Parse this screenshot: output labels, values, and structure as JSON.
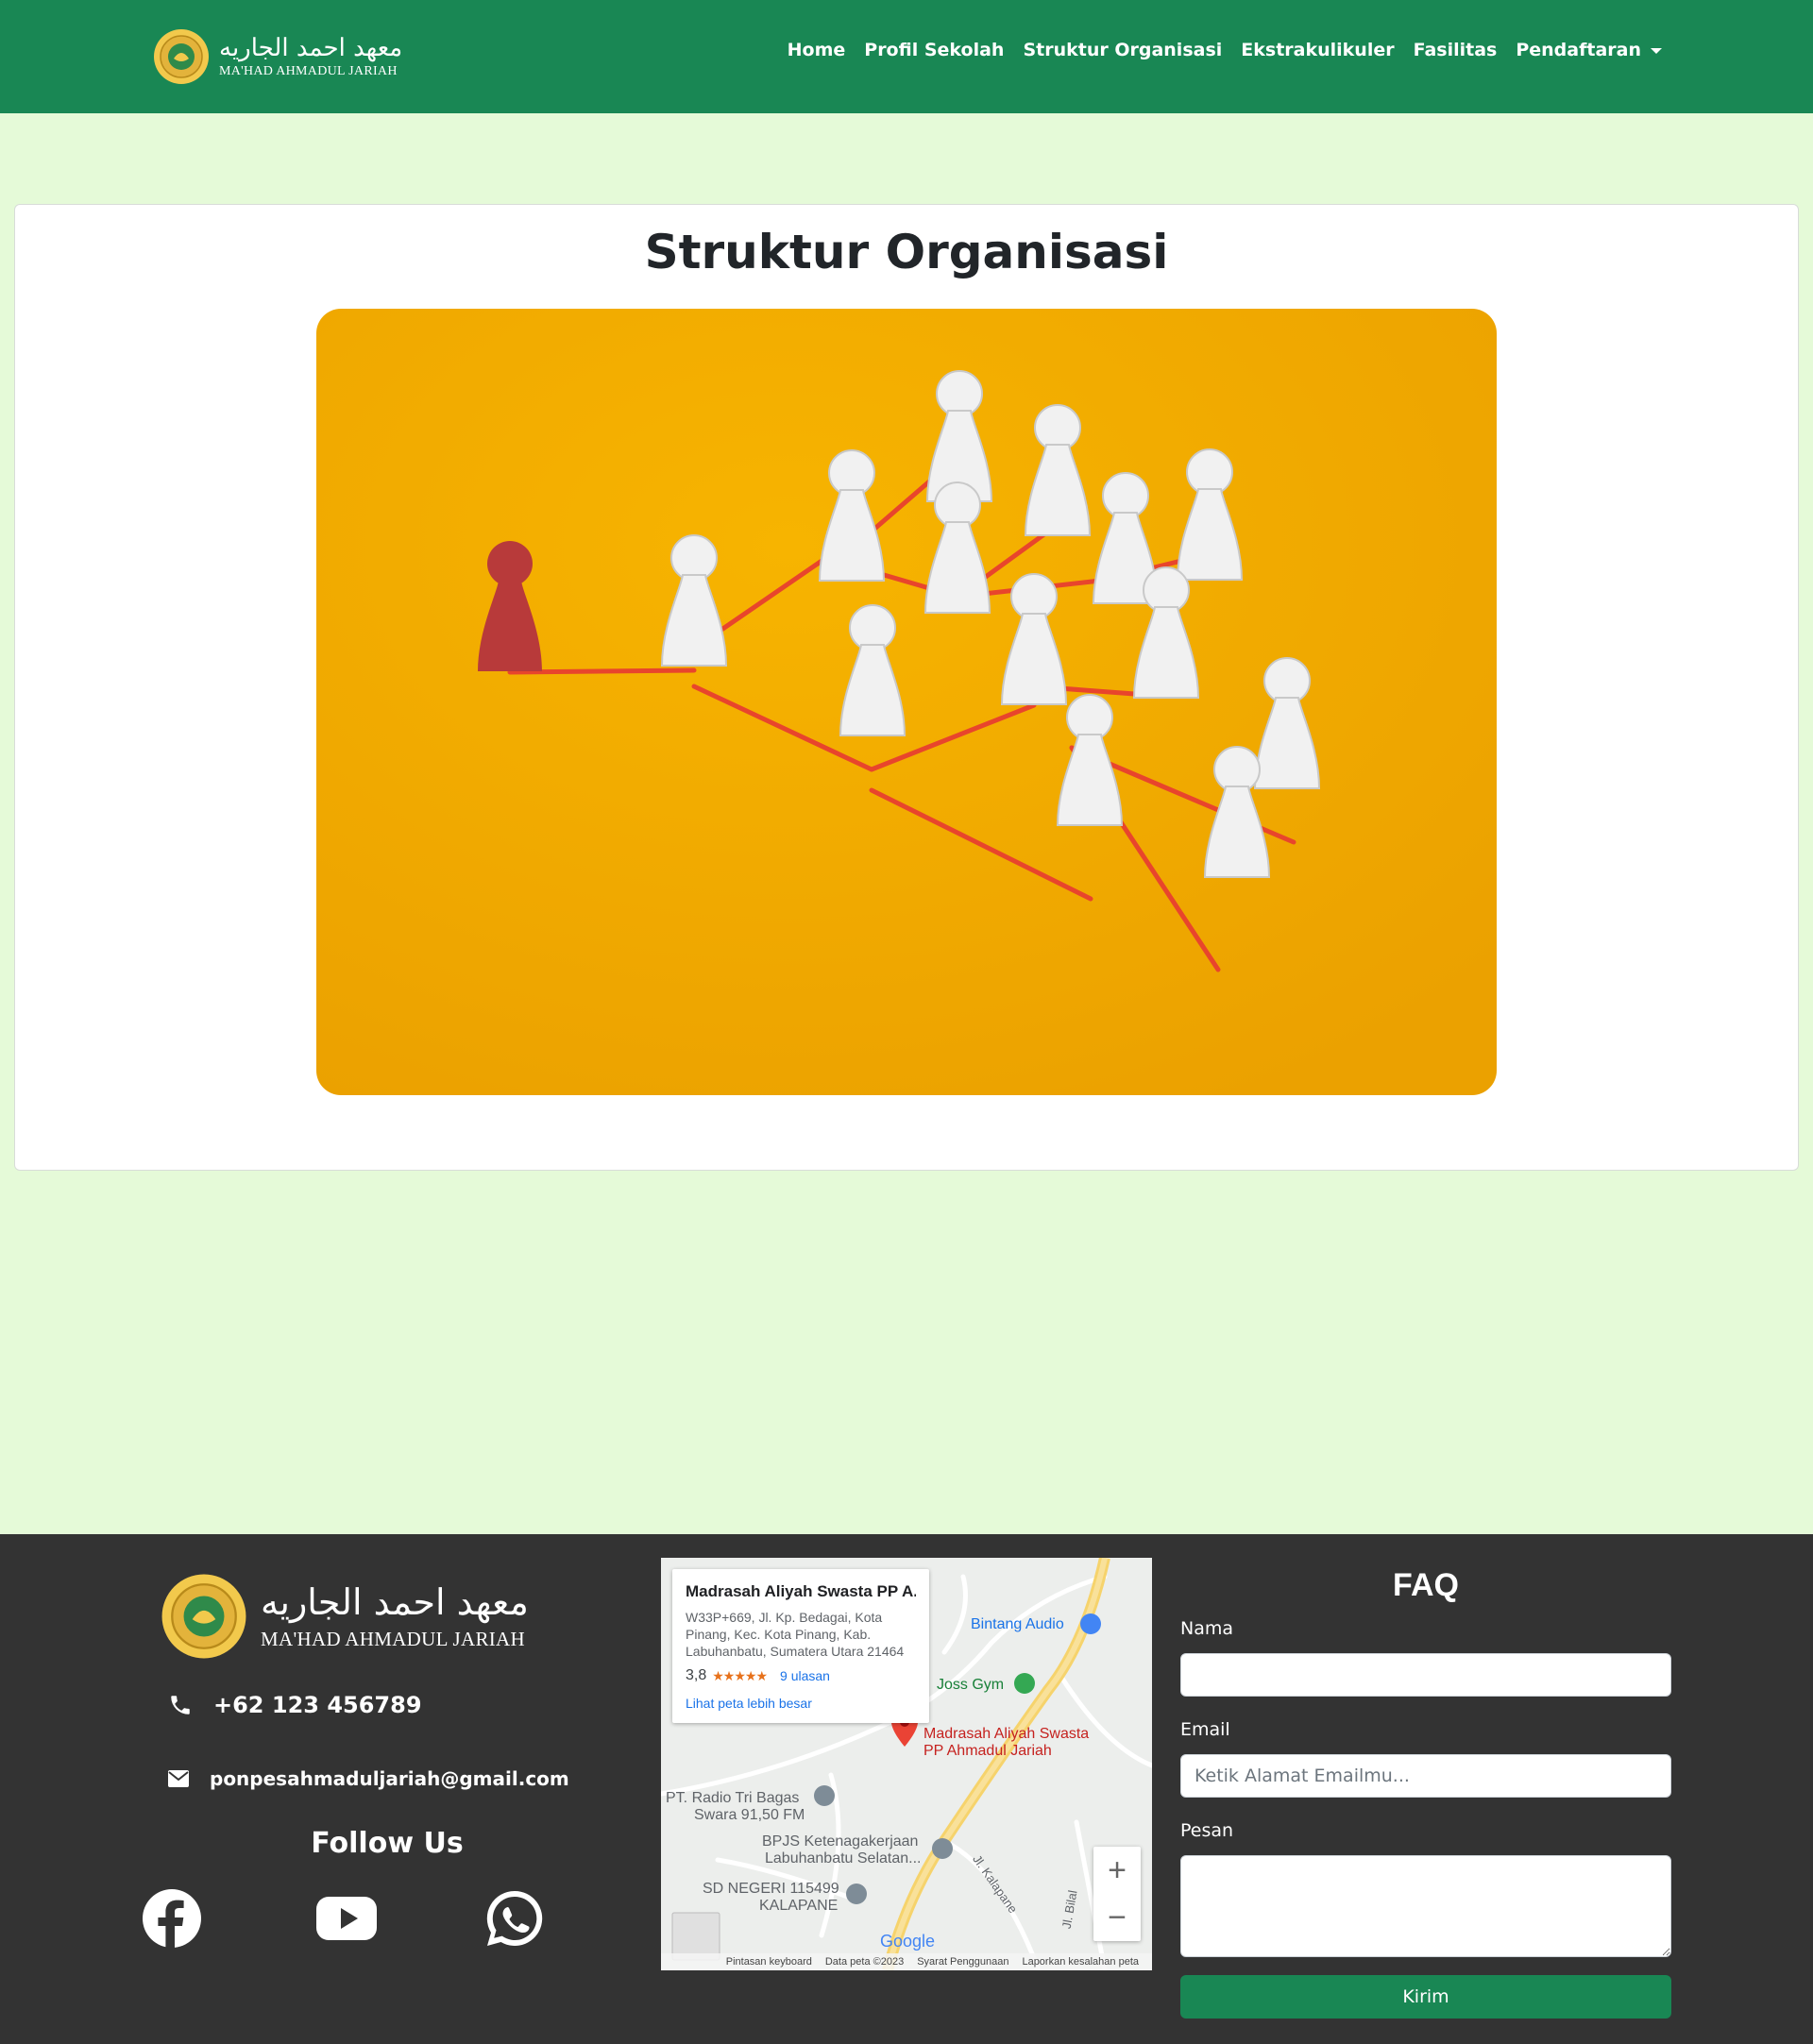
{
  "brand": {
    "arabic": "معهد احمد الجاريه",
    "latin": "MA'HAD AHMADUL JARIAH",
    "logo_icon": "school-emblem-icon",
    "logo_color": "#f2c94c"
  },
  "nav": {
    "items": [
      {
        "label": "Home"
      },
      {
        "label": "Profil Sekolah"
      },
      {
        "label": "Struktur Organisasi"
      },
      {
        "label": "Ekstrakulikuler"
      },
      {
        "label": "Fasilitas"
      },
      {
        "label": "Pendaftaran"
      }
    ],
    "dropdown_icon": "caret-down-icon"
  },
  "main": {
    "title": "Struktur Organisasi",
    "hero_image": "organization-network-figures-image"
  },
  "footer": {
    "brand": {
      "arabic": "معهد احمد الجاريه",
      "latin": "MA'HAD AHMADUL JARIAH"
    },
    "phone": "+62 123 456789",
    "email": "ponpesahmaduljariah@gmail.com",
    "follow_title": "Follow Us",
    "social": [
      "facebook-icon",
      "youtube-icon",
      "whatsapp-icon"
    ],
    "map": {
      "card_title": "Madrasah Aliyah Swasta PP A...",
      "card_address": "W33P+669, Jl. Kp. Bedagai, Kota Pinang, Kec. Kota Pinang, Kab. Labuhanbatu, Sumatera Utara 21464",
      "rating": "3,8",
      "stars": "★★★★★",
      "reviews": "9 ulasan",
      "link": "Lihat peta lebih besar",
      "marker_label_1": "Madrasah Aliyah Swasta",
      "marker_label_2": "PP Ahmadul Jariah",
      "places": {
        "bintang": "Bintang Audio",
        "joss": "Joss Gym",
        "radio_1": "PT. Radio Tri Bagas",
        "radio_2": "Swara 91,50 FM",
        "bpjs_1": "BPJS Ketenagakerjaan",
        "bpjs_2": "Labuhanbatu Selatan...",
        "sd_1": "SD NEGERI 115499",
        "sd_2": "KALAPANE",
        "road_1": "Jl. Kalapane",
        "road_2": "Jl. Bilal"
      },
      "zoom_in": "+",
      "zoom_out": "−",
      "google": "Google",
      "footer_links": [
        "Pintasan keyboard",
        "Data peta ©2023",
        "Syarat Penggunaan",
        "Laporkan kesalahan peta"
      ]
    },
    "faq": {
      "title": "FAQ",
      "name_label": "Nama",
      "name_value": "",
      "email_label": "Email",
      "email_placeholder": "Ketik Alamat Emailmu...",
      "message_label": "Pesan",
      "message_value": "",
      "submit_label": "Kirim"
    }
  },
  "colors": {
    "primary": "#198754",
    "background": "#e5fad8",
    "footer": "#333333",
    "hero_orange": "#f2a900",
    "leader_red": "#b83a3a",
    "link_line": "#e8452c"
  }
}
